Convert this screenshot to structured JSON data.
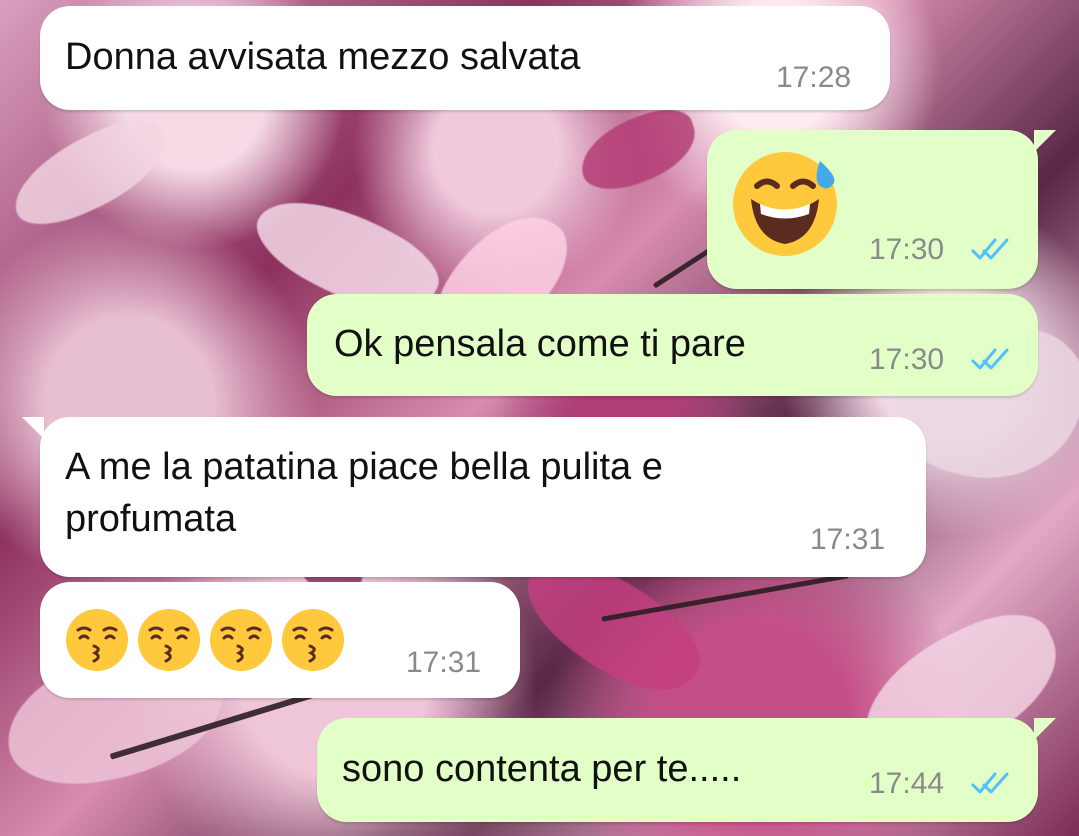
{
  "messages": [
    {
      "text": "Donna avvisata mezzo salvata",
      "time": "17:28"
    },
    {
      "emoji": "grinning-face-with-sweat-icon",
      "time": "17:30",
      "status": "read-double-check-icon"
    },
    {
      "text": "Ok pensala come ti pare",
      "time": "17:30",
      "status": "read-double-check-icon"
    },
    {
      "text_lines": [
        "A me la patatina piace bella pulita e",
        "profumata"
      ],
      "time": "17:31"
    },
    {
      "emojis": [
        "kissing-face-with-smiling-eyes-icon",
        "kissing-face-with-smiling-eyes-icon",
        "kissing-face-with-smiling-eyes-icon",
        "kissing-face-with-smiling-eyes-icon"
      ],
      "time": "17:31"
    },
    {
      "text": "sono contenta per te.....",
      "time": "17:44",
      "status": "read-double-check-icon"
    }
  ],
  "colors": {
    "incoming_bubble": "#ffffff",
    "outgoing_bubble": "#e2ffc8",
    "timestamp": "#8a8a8a",
    "read_check": "#4fc3f7",
    "emoji_face": "#ffc83d"
  }
}
